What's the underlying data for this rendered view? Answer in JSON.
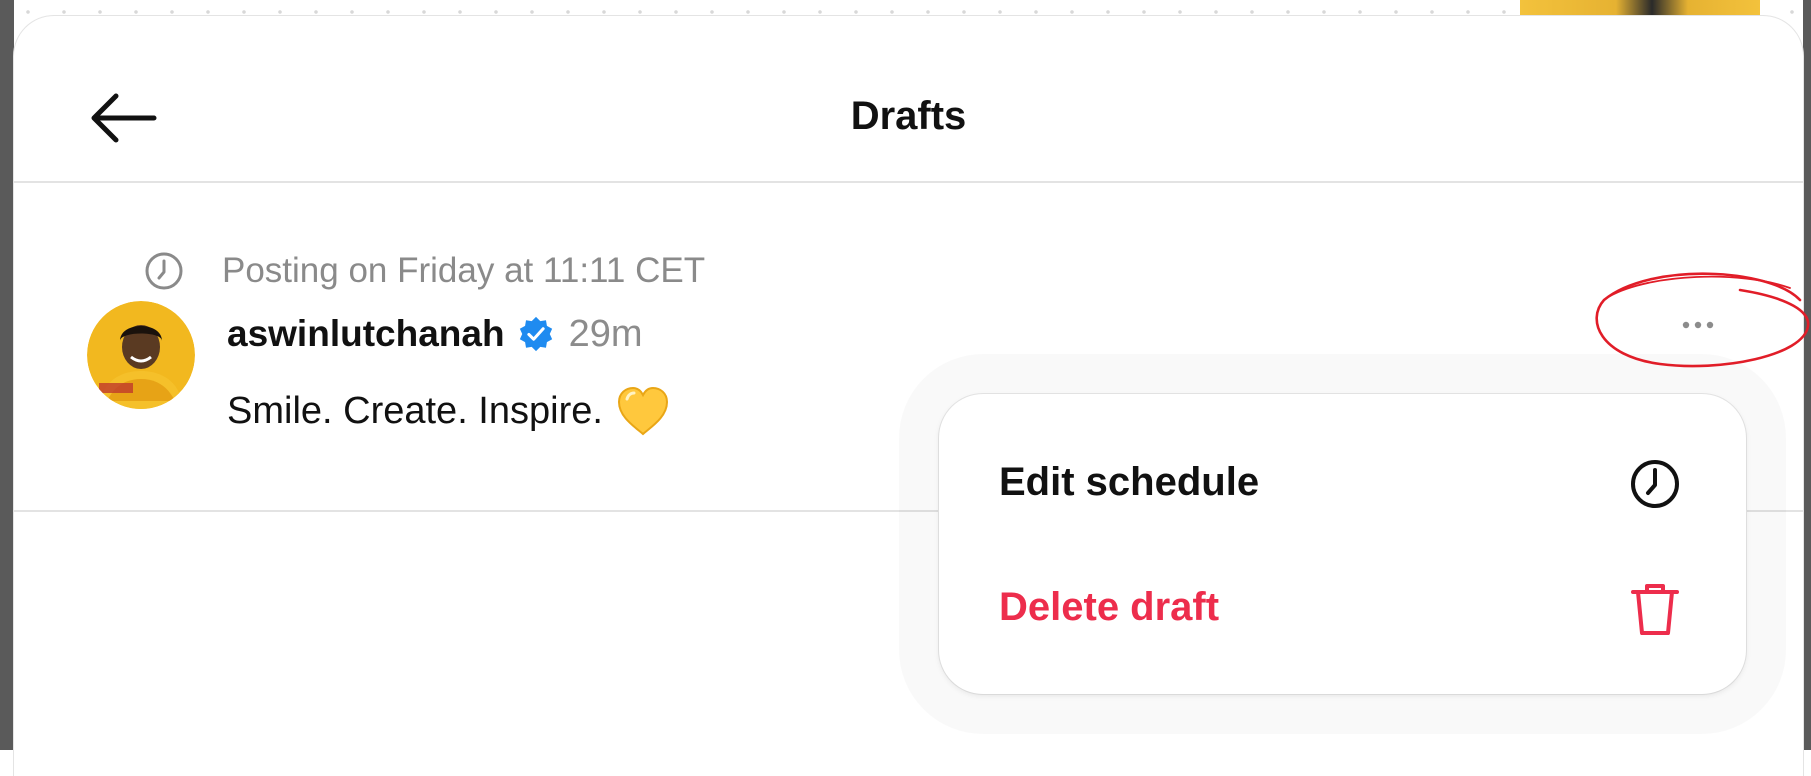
{
  "header": {
    "title": "Drafts",
    "back_icon": "arrow-left-icon"
  },
  "draft": {
    "schedule_icon": "clock-icon",
    "schedule_text": "Posting on Friday at 11:11 CET",
    "author": "aswinlutchanah",
    "verified_icon": "verified-badge-icon",
    "time": "29m",
    "text": "Smile. Create. Inspire.",
    "emoji_icon": "yellow-heart-icon",
    "more_icon": "more-dots-icon"
  },
  "menu": {
    "items": [
      {
        "label": "Edit schedule",
        "icon": "clock-icon",
        "color": "#111111"
      },
      {
        "label": "Delete draft",
        "icon": "trash-icon",
        "color": "#ed2d4c"
      }
    ]
  },
  "colors": {
    "verified": "#1f8bf0",
    "destructive": "#ed2d4c",
    "annotation": "#e11d28"
  }
}
